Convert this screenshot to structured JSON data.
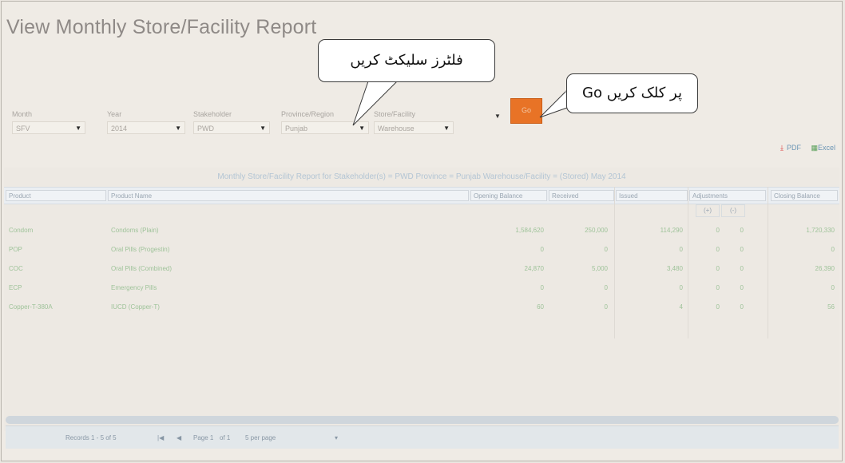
{
  "page": {
    "title": "View Monthly Store/Facility Report"
  },
  "filters": [
    {
      "label": "Month",
      "value": "SFV"
    },
    {
      "label": "Year",
      "value": "2014"
    },
    {
      "label": "Stakeholder",
      "value": "PWD"
    },
    {
      "label": "Province/Region",
      "value": "Punjab"
    },
    {
      "label": "Store/Facility",
      "value": "Warehouse"
    }
  ],
  "go_button": {
    "label": "Go"
  },
  "callouts": {
    "select_filters": "فلٹرز سلیکٹ کریں",
    "click_go": "Go پر کلک کریں"
  },
  "toolbar": {
    "pdf": "PDF",
    "excel": "Excel"
  },
  "grid": {
    "caption": "Monthly Store/Facility Report for Stakeholder(s) = PWD Province = Punjab Warehouse/Facility = (Stored) May 2014",
    "columns": [
      "Product",
      "Product Name",
      "Opening Balance",
      "Received",
      "Issued",
      "Adjustments",
      "Closing Balance"
    ],
    "adjust_sub": [
      "(+)",
      "(-)"
    ],
    "rows": [
      {
        "product": "Condom",
        "name": "Condoms (Plain)",
        "opening": "1,584,620",
        "received": "250,000",
        "issued": "114,290",
        "adj_plus": "0",
        "adj_minus": "0",
        "closing": "1,720,330"
      },
      {
        "product": "POP",
        "name": "Oral Pills (Progestin)",
        "opening": "0",
        "received": "0",
        "issued": "0",
        "adj_plus": "0",
        "adj_minus": "0",
        "closing": "0"
      },
      {
        "product": "COC",
        "name": "Oral Pills (Combined)",
        "opening": "24,870",
        "received": "5,000",
        "issued": "3,480",
        "adj_plus": "0",
        "adj_minus": "0",
        "closing": "26,390"
      },
      {
        "product": "ECP",
        "name": "Emergency Pills",
        "opening": "0",
        "received": "0",
        "issued": "0",
        "adj_plus": "0",
        "adj_minus": "0",
        "closing": "0"
      },
      {
        "product": "Copper-T-380A",
        "name": "IUCD (Copper-T)",
        "opening": "60",
        "received": "0",
        "issued": "4",
        "adj_plus": "0",
        "adj_minus": "0",
        "closing": "56"
      }
    ]
  },
  "pager": {
    "records": "Records 1 - 5 of 5",
    "page": "Page 1",
    "of": "of 1",
    "per_page": "5 per page"
  }
}
